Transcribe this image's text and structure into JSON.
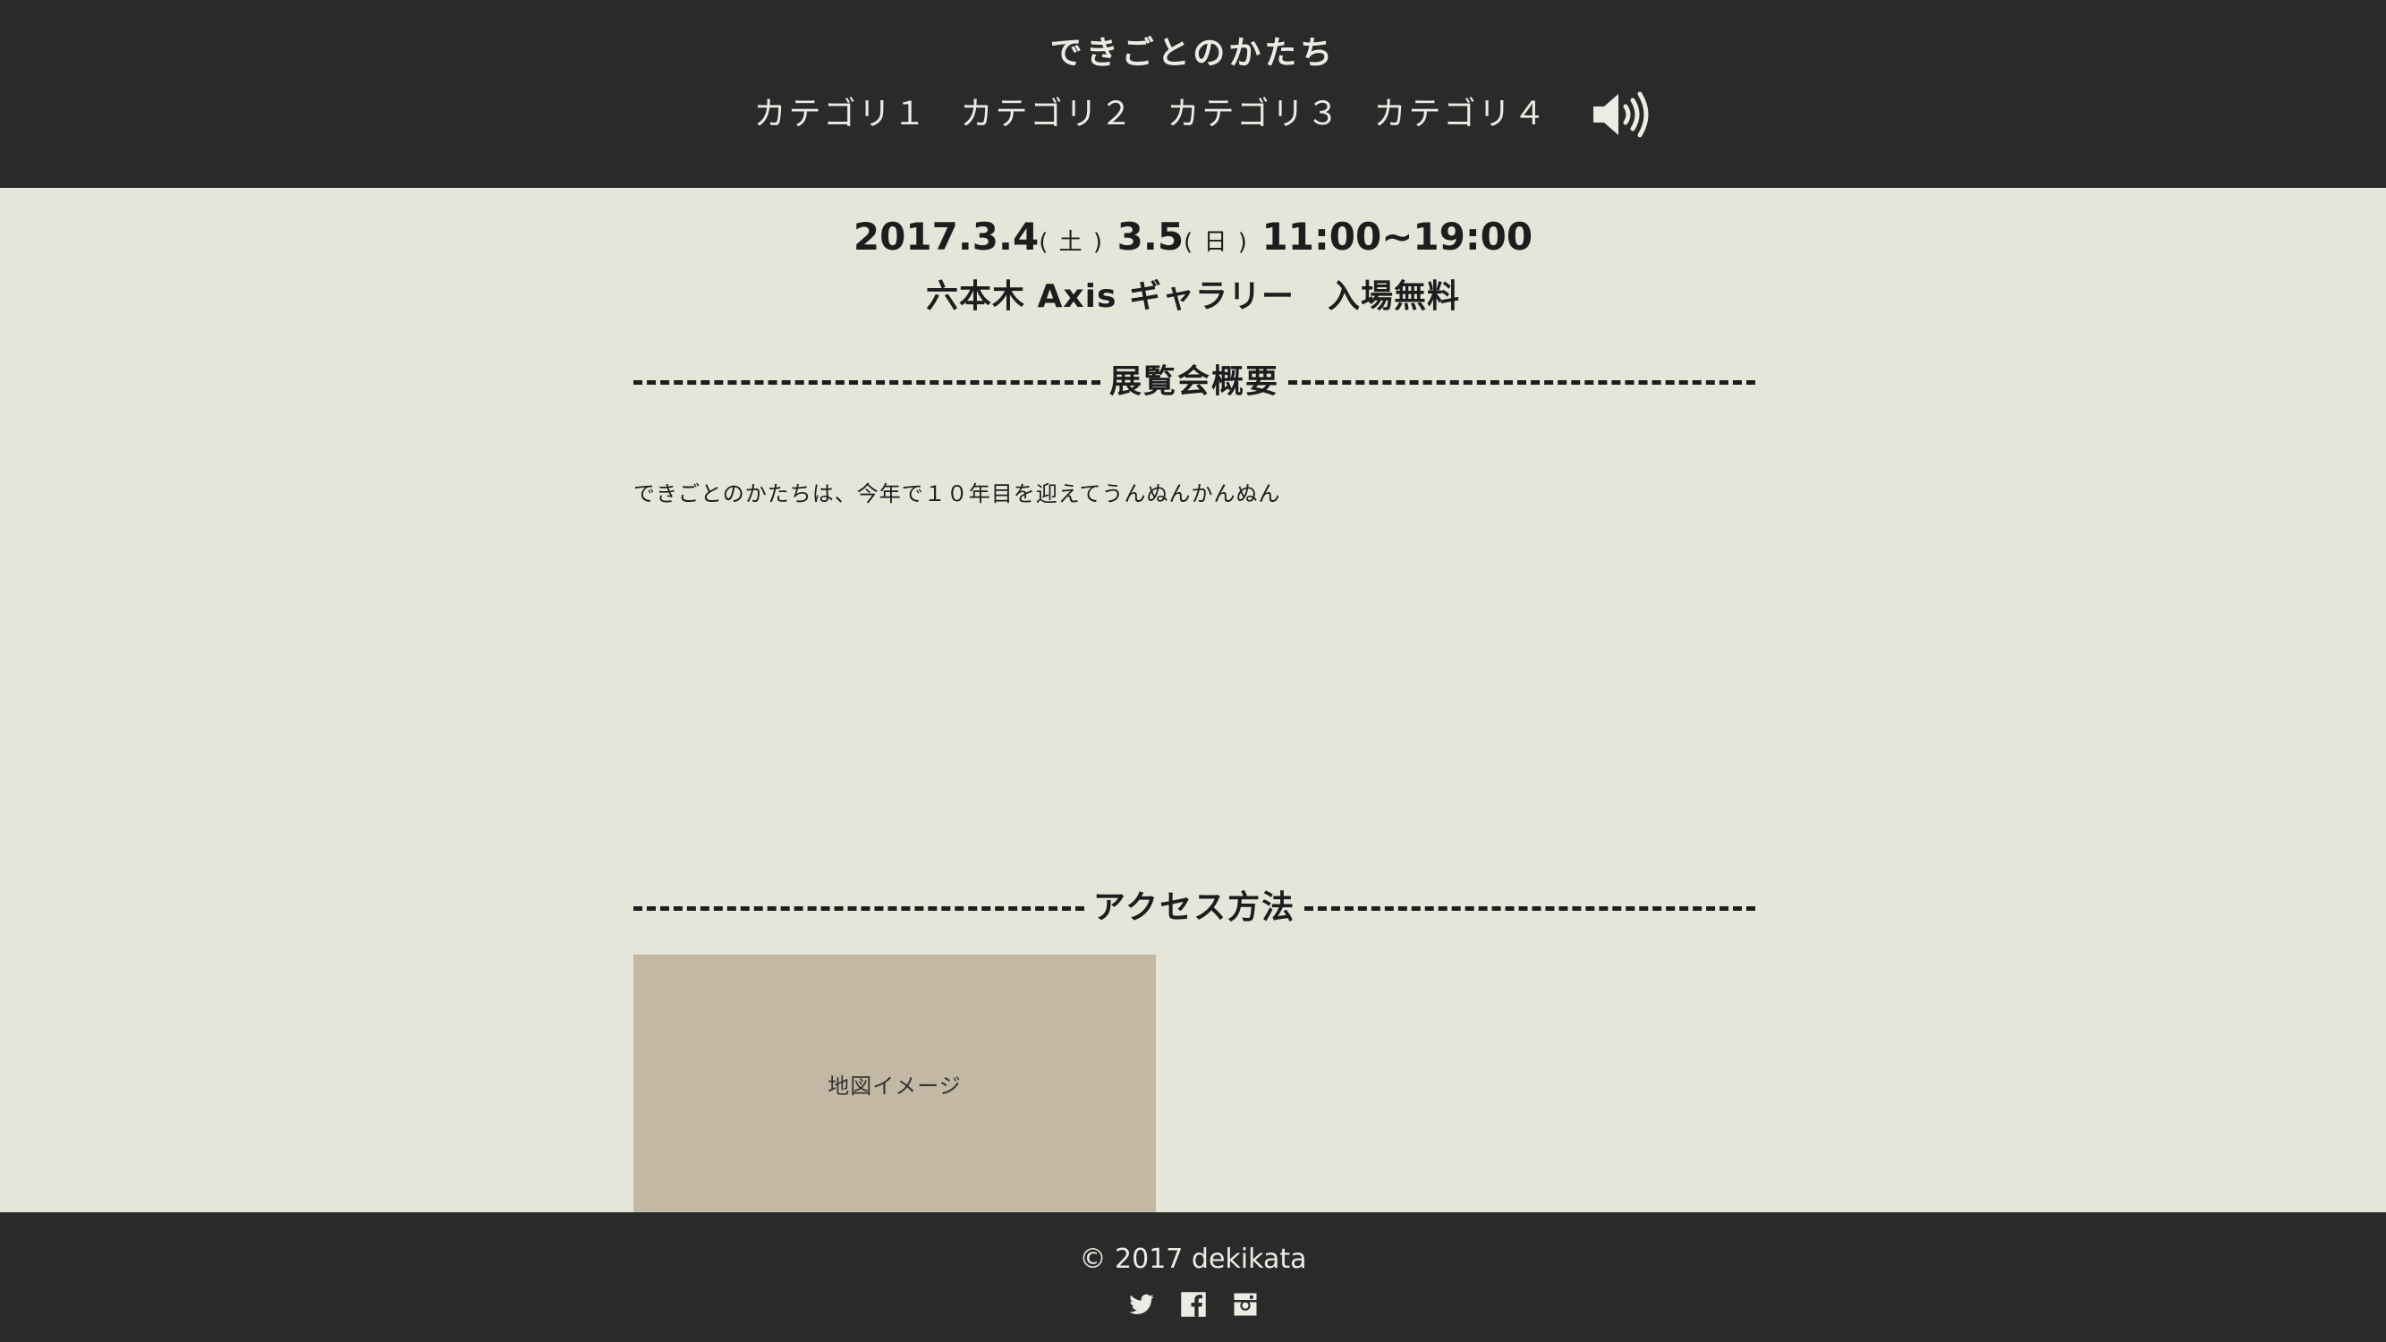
{
  "header": {
    "site_title": "できごとのかたち",
    "nav": [
      {
        "label": "カテゴリ１"
      },
      {
        "label": "カテゴリ２"
      },
      {
        "label": "カテゴリ３"
      },
      {
        "label": "カテゴリ４"
      }
    ],
    "sound_icon": "speaker-volume-icon"
  },
  "event": {
    "date1": "2017.3.4",
    "day1": "( 土 )",
    "date2": "3.5",
    "day2": "( 日 )",
    "time": "11:00~19:00",
    "venue": "六本木 Axis ギャラリー　入場無料"
  },
  "overview": {
    "heading": "展覧会概要",
    "text": "できごとのかたちは、今年で１０年目を迎えてうんぬんかんぬん"
  },
  "access": {
    "heading": "アクセス方法",
    "map_label": "地図イメージ"
  },
  "footer": {
    "copyright": "© 2017 dekikata",
    "social_icons": [
      "twitter-icon",
      "facebook-icon",
      "instagram-icon"
    ]
  },
  "colors": {
    "header_bg": "#292b2a",
    "page_bg": "#e5e5da",
    "map_bg": "#c3b8a4",
    "text": "#1c1d1d"
  }
}
